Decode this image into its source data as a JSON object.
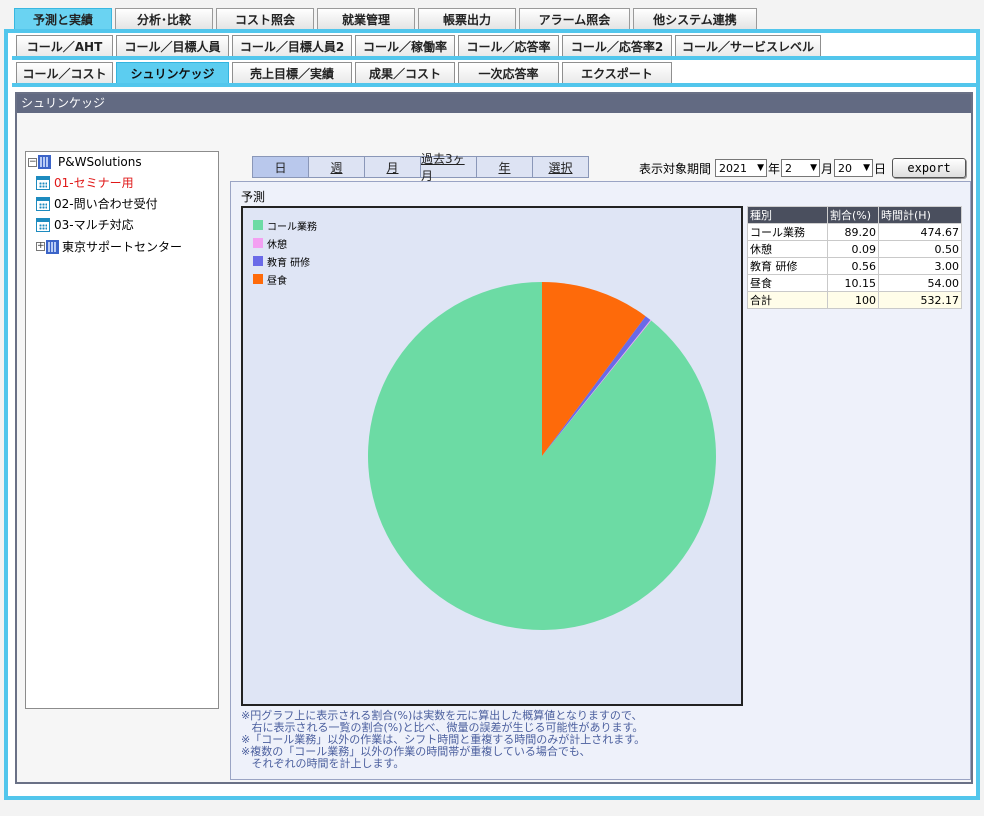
{
  "top_tabs": [
    "予測と実績",
    "分析･比較",
    "コスト照会",
    "就業管理",
    "帳票出力",
    "アラーム照会",
    "他システム連携"
  ],
  "sub_tabs_row1": [
    "コール／AHT",
    "コール／目標人員",
    "コール／目標人員2",
    "コール／稼働率",
    "コール／応答率",
    "コール／応答率2",
    "コール／サービスレベル"
  ],
  "sub_tabs_row2": [
    "コール／コスト",
    "シュリンケッジ",
    "売上目標／実績",
    "成果／コスト",
    "一次応答率",
    "エクスポート"
  ],
  "panel_title": "シュリンケッジ",
  "tree": {
    "root": "P&WSolutions",
    "items": [
      "01-セミナー用",
      "02-問い合わせ受付",
      "03-マルチ対応",
      "東京サポートセンター"
    ],
    "root_expander": "−",
    "group_expander": "+"
  },
  "period_buttons": [
    "日",
    "週",
    "月",
    "過去3ヶ月",
    "年",
    "選択"
  ],
  "date_selector": {
    "label": "表示対象期間",
    "year": "2021",
    "year_unit": "年",
    "month": "2",
    "month_unit": "月",
    "day": "20",
    "day_unit": "日",
    "dropdown_glyph": "▼",
    "export_label": "export"
  },
  "content_title": "予測",
  "legend": [
    "コール業務",
    "休憩",
    "教育 研修",
    "昼食"
  ],
  "colors": {
    "call": "#6cdba4",
    "break": "#f3a0f2",
    "training": "#6a6ae8",
    "lunch": "#fe6a0a"
  },
  "table": {
    "headers": [
      "種別",
      "割合(%)",
      "時間計(H)"
    ],
    "rows": [
      [
        "コール業務",
        "89.20",
        "474.67"
      ],
      [
        "休憩",
        "0.09",
        "0.50"
      ],
      [
        "教育 研修",
        "0.56",
        "3.00"
      ],
      [
        "昼食",
        "10.15",
        "54.00"
      ]
    ],
    "total": [
      "合計",
      "100",
      "532.17"
    ]
  },
  "chart_data": {
    "type": "pie",
    "categories": [
      "コール業務",
      "休憩",
      "教育 研修",
      "昼食"
    ],
    "values": [
      89.2,
      0.09,
      0.56,
      10.15
    ],
    "title": "",
    "start": "top",
    "direction": "counterclockwise"
  },
  "notes": [
    "※円グラフ上に表示される割合(%)は実数を元に算出した概算値となりますので、",
    "   右に表示される一覧の割合(%)と比べ、微量の誤差が生じる可能性があります。",
    "※「コール業務」以外の作業は、シフト時間と重複する時間のみが計上されます。",
    "※複数の「コール業務」以外の作業の時間帯が重複している場合でも、",
    "   それぞれの時間を計上します。"
  ]
}
